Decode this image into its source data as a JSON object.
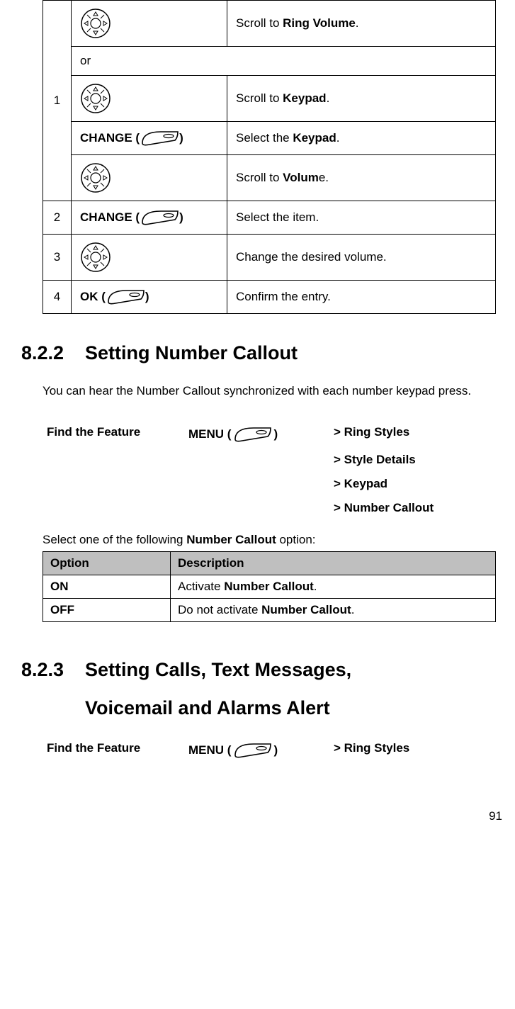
{
  "steps_table": {
    "row1_num": "1",
    "r1a_pre": "Scroll to ",
    "r1a_bold": "Ring Volume",
    "r1a_post": ".",
    "or": "or",
    "r1b_pre": "Scroll to ",
    "r1b_bold": "Keypad",
    "r1b_post": ".",
    "r1c_lbl_pre": "CHANGE (",
    "r1c_lbl_post": ")",
    "r1c_pre": "Select the ",
    "r1c_bold": "Keypad",
    "r1c_post": ".",
    "r1d_pre": "Scroll to ",
    "r1d_bold": "Volum",
    "r1d_post": "e.",
    "row2_num": "2",
    "r2_lbl_pre": "CHANGE (",
    "r2_lbl_post": ")",
    "r2_desc": "Select the item.",
    "row3_num": "3",
    "r3_desc": "Change the desired volume.",
    "row4_num": "4",
    "r4_lbl_pre": "OK (",
    "r4_lbl_post": ")",
    "r4_desc": "Confirm the entry."
  },
  "sec822": {
    "num": "8.2.2",
    "title": "Setting Number Callout",
    "para": "You can hear the Number Callout synchronized with each number keypad press.",
    "find_label": "Find the Feature",
    "menu_pre": "MENU (",
    "menu_post": ")",
    "nav1": "> Ring Styles",
    "nav2": "> Style Details",
    "nav3": "> Keypad",
    "nav4": "> Number Callout",
    "select_pre": "Select one of the following ",
    "select_bold": "Number Callout",
    "select_post": " option:",
    "th_opt": "Option",
    "th_desc": "Description",
    "on": "ON",
    "on_pre": "Activate ",
    "on_bold": "Number Callout",
    "on_post": ".",
    "off": "OFF",
    "off_pre": "Do not activate ",
    "off_bold": "Number Callout",
    "off_post": "."
  },
  "sec823": {
    "num": "8.2.3",
    "title1": "Setting Calls, Text Messages,",
    "title2": "Voicemail and Alarms Alert",
    "find_label": "Find the Feature",
    "menu_pre": "MENU (",
    "menu_post": ")",
    "nav1": "> Ring Styles"
  },
  "page_number": "91"
}
